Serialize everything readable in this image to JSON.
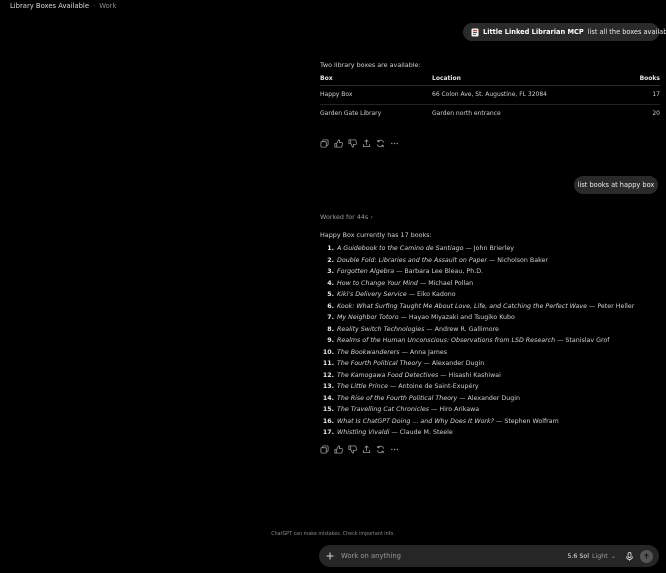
{
  "header": {
    "title": "Library Boxes Available",
    "separator": "·",
    "project": "Work"
  },
  "messages": {
    "user1": {
      "mcp_name": "Little Linked Librarian MCP",
      "text": "list all the boxes available"
    },
    "assistant1": {
      "intro": "Two library boxes are available:",
      "table": {
        "headers": [
          "Box",
          "Location",
          "Books"
        ],
        "rows": [
          [
            "Happy Box",
            "66 Colon Ave, St. Augustine, FL 32084",
            "17"
          ],
          [
            "Garden Gate Library",
            "Garden north entrance",
            "20"
          ]
        ]
      }
    },
    "user2": {
      "text": "list books at happy box"
    },
    "assistant2": {
      "worked": "Worked for 44s",
      "worked_chevron": "›",
      "summary": "Happy Box currently has 17 books:",
      "books": [
        {
          "num": "1.",
          "title": "A Guidebook to the Camino de Santiago",
          "author": " — John Brierley"
        },
        {
          "num": "2.",
          "title": "Double Fold: Libraries and the Assault on Paper",
          "author": " — Nicholson Baker"
        },
        {
          "num": "3.",
          "title": "Forgotten Algebra",
          "author": " — Barbara Lee Bleau, Ph.D."
        },
        {
          "num": "4.",
          "title": "How to Change Your Mind",
          "author": " — Michael Pollan"
        },
        {
          "num": "5.",
          "title": "Kiki's Delivery Service",
          "author": " — Eiko Kadono"
        },
        {
          "num": "6.",
          "title": "Kook: What Surfing Taught Me About Love, Life, and Catching the Perfect Wave",
          "author": " — Peter Heller"
        },
        {
          "num": "7.",
          "title": "My Neighbor Totoro",
          "author": " — Hayao Miyazaki and Tsugiko Kubo"
        },
        {
          "num": "8.",
          "title": "Reality Switch Technologies",
          "author": " — Andrew R. Gallimore"
        },
        {
          "num": "9.",
          "title": "Realms of the Human Unconscious: Observations from LSD Research",
          "author": " — Stanislav Grof"
        },
        {
          "num": "10.",
          "title": "The Bookwanderers",
          "author": " — Anna James"
        },
        {
          "num": "11.",
          "title": "The Fourth Political Theory",
          "author": " — Alexander Dugin"
        },
        {
          "num": "12.",
          "title": "The Kamogawa Food Detectives",
          "author": " — Hisashi Kashiwai"
        },
        {
          "num": "13.",
          "title": "The Little Prince",
          "author": " — Antoine de Saint-Exupéry"
        },
        {
          "num": "14.",
          "title": "The Rise of the Fourth Political Theory",
          "author": " — Alexander Dugin"
        },
        {
          "num": "15.",
          "title": "The Travelling Cat Chronicles",
          "author": " — Hiro Arikawa"
        },
        {
          "num": "16.",
          "title": "What Is ChatGPT Doing ... and Why Does It Work?",
          "author": " — Stephen Wolfram"
        },
        {
          "num": "17.",
          "title": "Whistling Vivaldi",
          "author": " — Claude M. Steele"
        }
      ]
    }
  },
  "action_icons": [
    "copy-icon",
    "thumbs-up-icon",
    "thumbs-down-icon",
    "share-icon",
    "regenerate-icon",
    "more-icon"
  ],
  "disclaimer": "ChatGPT can make mistakes. Check important info.",
  "composer": {
    "placeholder": "Work on anything",
    "model_name": "5.6 Sol",
    "model_mode": "Light",
    "chevron": "⌄"
  }
}
